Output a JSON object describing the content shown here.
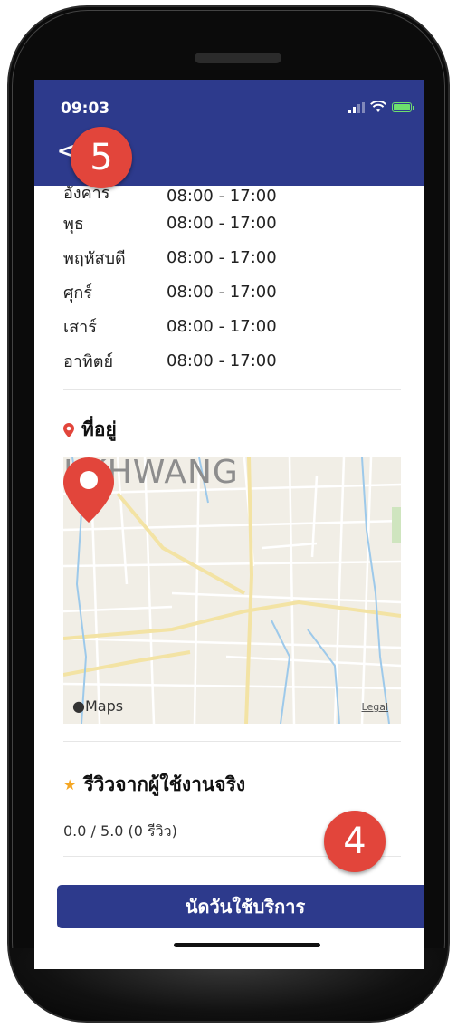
{
  "status": {
    "time": "09:03"
  },
  "header": {
    "back_glyph": "<"
  },
  "hours": [
    {
      "day": "อังคาร",
      "time": "08:00 - 17:00"
    },
    {
      "day": "พุธ",
      "time": "08:00 - 17:00"
    },
    {
      "day": "พฤหัสบดี",
      "time": "08:00 - 17:00"
    },
    {
      "day": "ศุกร์",
      "time": "08:00 - 17:00"
    },
    {
      "day": "เสาร์",
      "time": "08:00 - 17:00"
    },
    {
      "day": "อาทิตย์",
      "time": "08:00 - 17:00"
    }
  ],
  "address": {
    "title": "ที่อยู่",
    "map_area_label": "I KHWANG",
    "maps_logo": "Maps",
    "legal": "Legal"
  },
  "reviews": {
    "title": "รีวิวจากผู้ใช้งานจริง",
    "summary": "0.0 / 5.0 (0 รีวิว)"
  },
  "cta": {
    "label": "นัดวันใช้บริการ"
  },
  "annotations": {
    "badge_a": "5",
    "badge_b": "4"
  },
  "colors": {
    "primary": "#2d3a8c",
    "marker": "#e2453b",
    "star": "#f5a623",
    "pin": "#e2453b"
  }
}
